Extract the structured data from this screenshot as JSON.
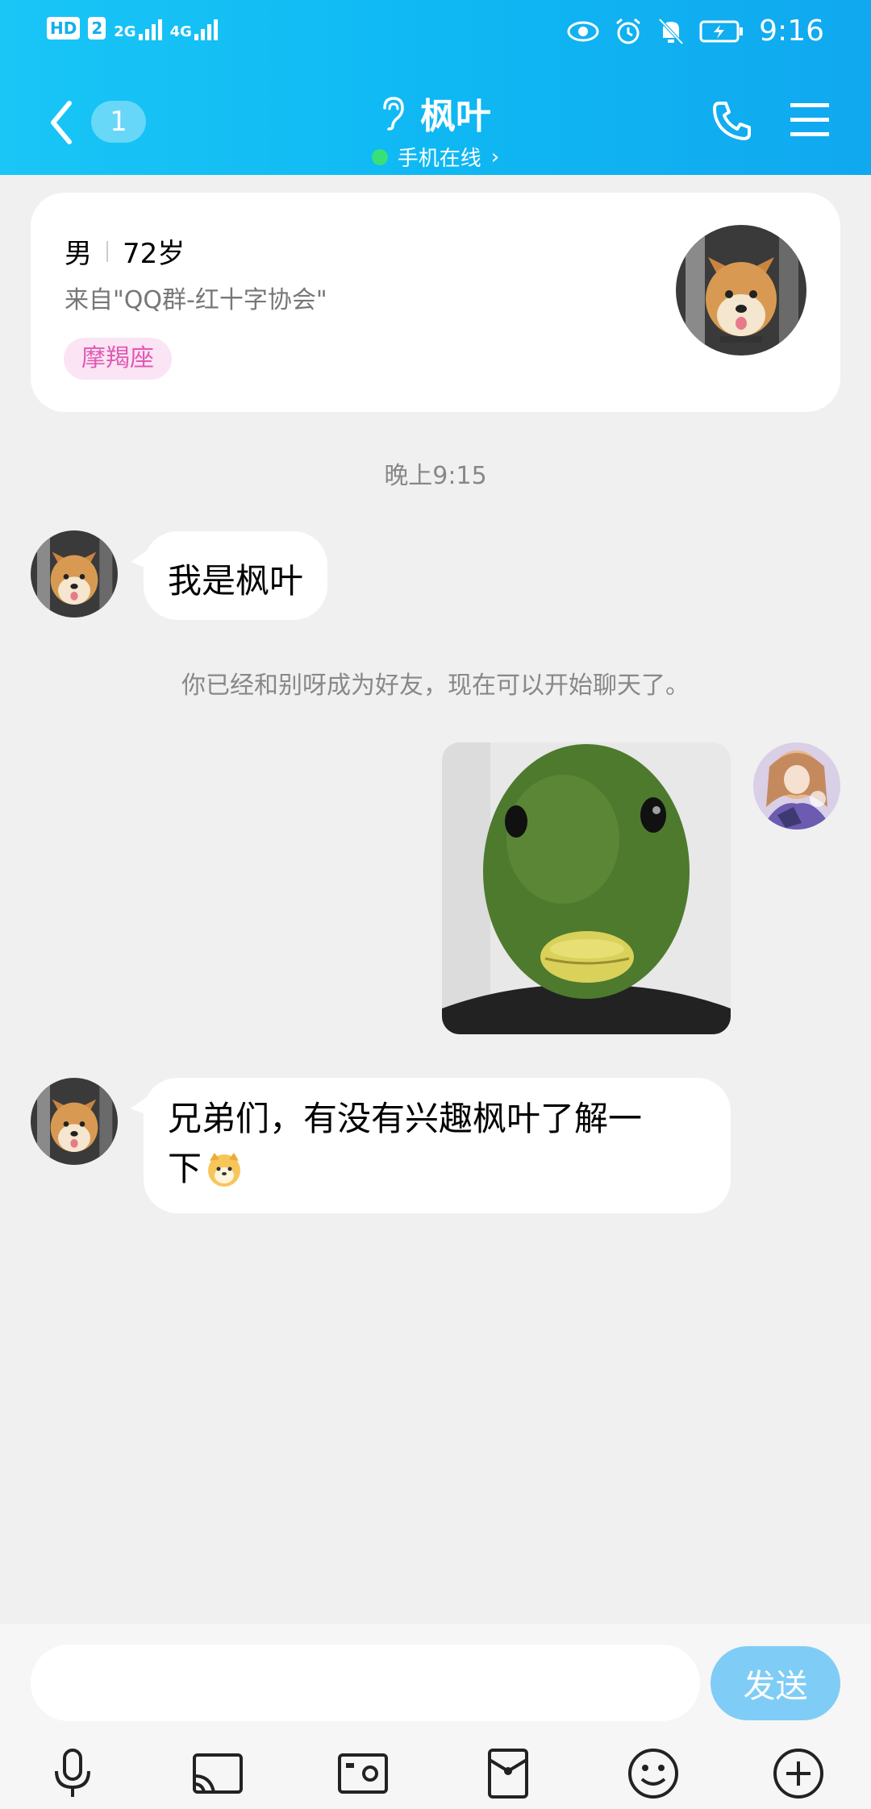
{
  "status_bar": {
    "hd_label": "HD",
    "sim_label": "2",
    "net1": "2G",
    "net2": "4G",
    "time": "9:16"
  },
  "nav": {
    "unread_count": "1",
    "title": "枫叶",
    "status": "手机在线",
    "status_chevron": "›"
  },
  "profile": {
    "gender": "男",
    "age": "72岁",
    "source": "来自\"QQ群-红十字协会\"",
    "tag": "摩羯座"
  },
  "chat": {
    "time_divider": "晚上9:15",
    "messages": [
      {
        "text": "我是枫叶"
      },
      {
        "notice": "你已经和别呀成为好友，现在可以开始聊天了。"
      },
      {
        "text_line1": "兄弟们，有没有兴趣枫叶了解一",
        "text_line2": "下"
      }
    ]
  },
  "input": {
    "value": "",
    "send_label": "发送"
  },
  "colors": {
    "header_start": "#19c6f6",
    "header_end": "#10a8ef",
    "send_button": "#7fcdf6",
    "tag_bg": "#fbe4f3",
    "tag_text": "#e15ab5",
    "online": "#38e07a"
  },
  "icons": [
    "back-icon",
    "ear-icon",
    "phone-icon",
    "menu-icon",
    "mic-icon",
    "screen-cast-icon",
    "photo-icon",
    "red-packet-icon",
    "emoji-icon",
    "plus-icon"
  ]
}
